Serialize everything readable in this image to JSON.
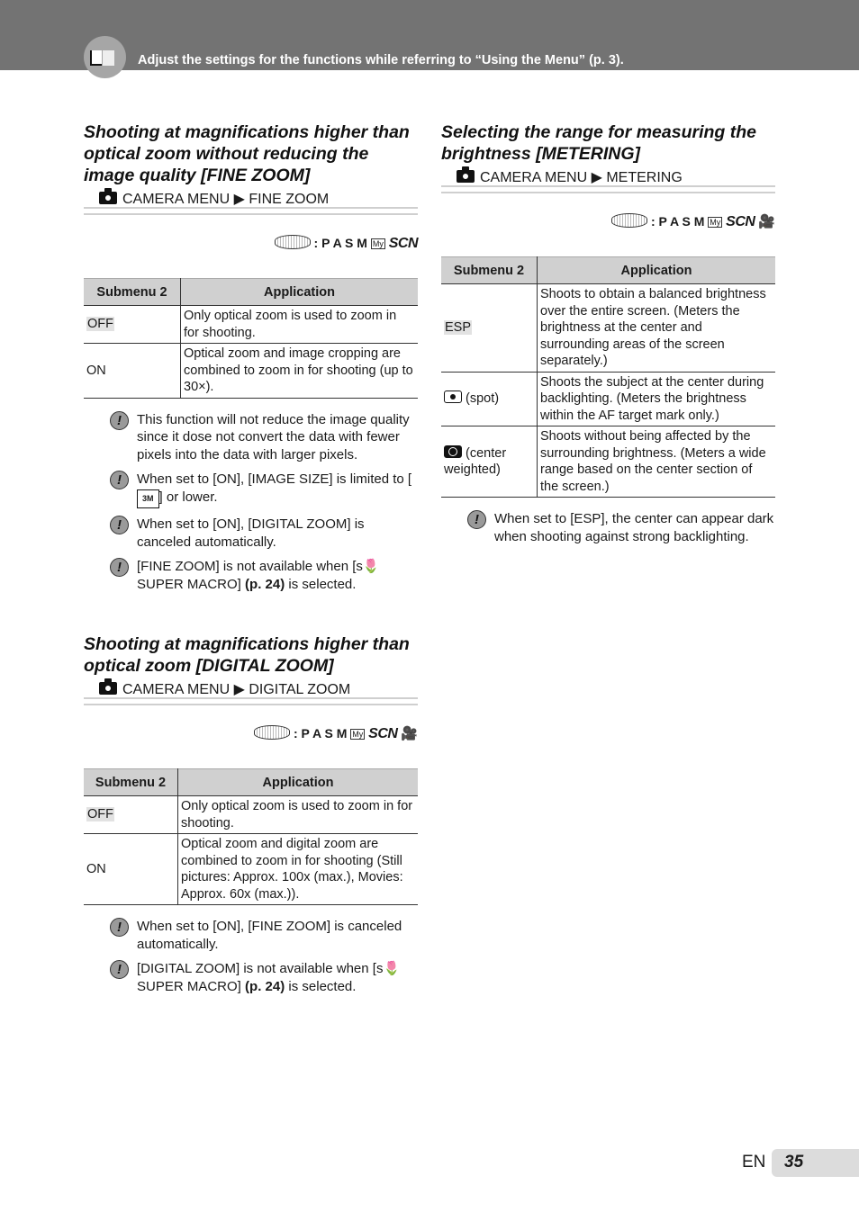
{
  "header": {
    "instruction": "Adjust the settings for the functions while referring to “Using the Menu” (p. 3).",
    "icon": "book-icon"
  },
  "modes": {
    "separator": ":",
    "letters": "P A S M",
    "myset": "My",
    "scn": "SCN",
    "movie": "🎥"
  },
  "fine_zoom": {
    "title": "Shooting at magnifications higher than optical zoom without reducing the image quality [FINE ZOOM]",
    "path_menu": "CAMERA MENU",
    "path_arrow": "▶",
    "path_item": "FINE ZOOM",
    "headers": [
      "Submenu 2",
      "Application"
    ],
    "rows": [
      {
        "submenu": "OFF",
        "application": "Only optical zoom is used to zoom in for shooting."
      },
      {
        "submenu": "ON",
        "application": "Optical zoom and image cropping are combined to zoom in for shooting (up to 30×)."
      }
    ],
    "notes": [
      "This function will not reduce the image quality since it dose not convert the data with fewer pixels into the data with larger pixels.",
      "When set to [ON], [IMAGE SIZE] is limited to [",
      "When set to [ON], [DIGITAL ZOOM] is canceled automatically.",
      "[FINE ZOOM] is not available when ["
    ],
    "note2_icon_label": "3M",
    "note2_tail": "] or lower.",
    "note4_macro": "s🌷 SUPER MACRO]",
    "note4_ref": "(p. 24)",
    "note4_tail": "is selected."
  },
  "digital_zoom": {
    "title": "Shooting at magnifications higher than optical zoom [DIGITAL ZOOM]",
    "path_menu": "CAMERA MENU",
    "path_arrow": "▶",
    "path_item": "DIGITAL ZOOM",
    "headers": [
      "Submenu 2",
      "Application"
    ],
    "rows": [
      {
        "submenu": "OFF",
        "application": "Only optical zoom is used to zoom in for shooting."
      },
      {
        "submenu": "ON",
        "application": "Optical zoom and digital zoom are combined to zoom in for shooting (Still pictures: Approx. 100x (max.), Movies: Approx. 60x (max.))."
      }
    ],
    "notes": [
      "When set to [ON], [FINE ZOOM] is canceled automatically.",
      "[DIGITAL ZOOM] is not available when ["
    ],
    "note2_macro": "s🌷 SUPER MACRO]",
    "note2_ref": "(p. 24)",
    "note2_tail": "is selected."
  },
  "metering": {
    "title": "Selecting the range for measuring the brightness [METERING]",
    "path_menu": "CAMERA MENU",
    "path_arrow": "▶",
    "path_item": "METERING",
    "headers": [
      "Submenu 2",
      "Application"
    ],
    "rows": [
      {
        "submenu": "ESP",
        "application": "Shoots to obtain a balanced brightness over the entire screen. (Meters the brightness at the center and surrounding areas of the screen separately.)"
      },
      {
        "submenu": "(spot)",
        "application": "Shoots the subject at the center during backlighting. (Meters the brightness within the AF target mark only.)"
      },
      {
        "submenu": "(center weighted)",
        "application": "Shoots without being affected by the surrounding brightness. (Meters a wide range based on the center section of the screen.)"
      }
    ],
    "notes": [
      "When set to [ESP], the center can appear dark when shooting against strong backlighting."
    ]
  },
  "footer": {
    "lang": "EN",
    "page": "35"
  }
}
